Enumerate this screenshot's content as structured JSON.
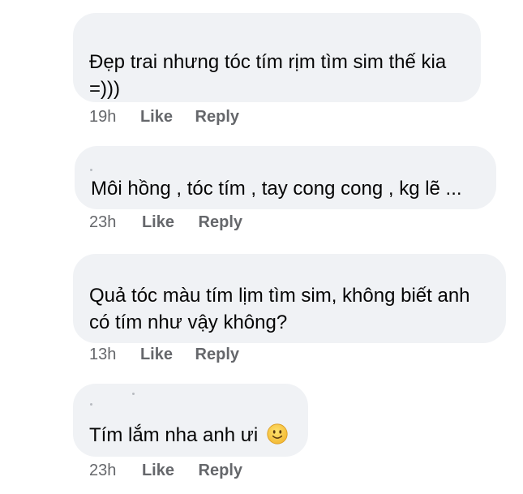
{
  "comments": [
    {
      "lines": [
        "Đẹp trai nhưng tóc tím rịm tìm sim thế kia",
        "=)))"
      ],
      "time": "19h",
      "like_label": "Like",
      "reply_label": "Reply"
    },
    {
      "lines": [
        "Môi hồng , tóc tím , tay cong cong , kg lẽ ..."
      ],
      "time": "23h",
      "like_label": "Like",
      "reply_label": "Reply"
    },
    {
      "lines": [
        "Quả tóc màu tím lịm tìm sim, không biết anh",
        "có tím như vậy không?"
      ],
      "time": "13h",
      "like_label": "Like",
      "reply_label": "Reply"
    },
    {
      "lines": [
        "Tím lắm nha anh ưi"
      ],
      "emoji": "slightly-smiling-face-icon",
      "time": "23h",
      "like_label": "Like",
      "reply_label": "Reply"
    }
  ],
  "colors": {
    "bubble_bg": "#f0f2f5",
    "text": "#050505",
    "meta": "#65676b",
    "emoji_face": "#f7c544"
  }
}
